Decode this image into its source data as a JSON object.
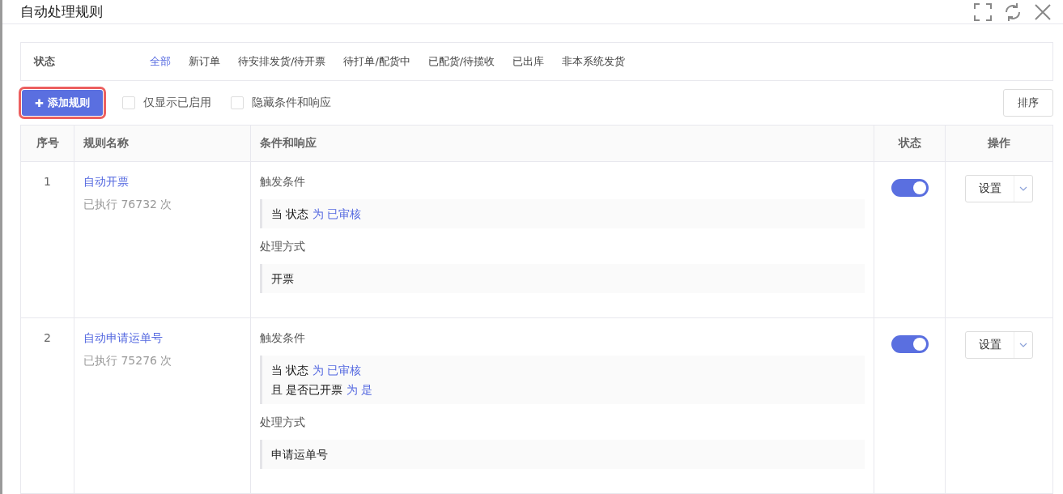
{
  "window": {
    "title": "自动处理规则"
  },
  "filter": {
    "label": "状态",
    "options": [
      {
        "label": "全部",
        "selected": true
      },
      {
        "label": "新订单",
        "selected": false
      },
      {
        "label": "待安排发货/待开票",
        "selected": false
      },
      {
        "label": "待打单/配货中",
        "selected": false
      },
      {
        "label": "已配货/待揽收",
        "selected": false
      },
      {
        "label": "已出库",
        "selected": false
      },
      {
        "label": "非本系统发货",
        "selected": false
      }
    ]
  },
  "toolbar": {
    "add_button": "添加规则",
    "add_icon": "✚",
    "checkboxes": [
      {
        "label": "仅显示已启用",
        "checked": false
      },
      {
        "label": "隐藏条件和响应",
        "checked": false
      }
    ],
    "sort_button": "排序"
  },
  "table": {
    "columns": [
      "序号",
      "规则名称",
      "条件和响应",
      "状态",
      "操作"
    ],
    "rows": [
      {
        "index": "1",
        "name": "自动开票",
        "executed": "已执行 76732 次",
        "trigger_label": "触发条件",
        "conditions": [
          [
            {
              "kind": "word",
              "text": "当"
            },
            {
              "kind": "field",
              "text": "状态"
            },
            {
              "kind": "op",
              "text": "为"
            },
            {
              "kind": "value",
              "text": "已审核"
            }
          ]
        ],
        "action_label": "处理方式",
        "action": "开票",
        "on": true,
        "button": "设置"
      },
      {
        "index": "2",
        "name": "自动申请运单号",
        "executed": "已执行 75276 次",
        "trigger_label": "触发条件",
        "conditions": [
          [
            {
              "kind": "word",
              "text": "当"
            },
            {
              "kind": "field",
              "text": "状态"
            },
            {
              "kind": "op",
              "text": "为"
            },
            {
              "kind": "value",
              "text": "已审核"
            }
          ],
          [
            {
              "kind": "word",
              "text": "且"
            },
            {
              "kind": "field",
              "text": "是否已开票"
            },
            {
              "kind": "op",
              "text": "为"
            },
            {
              "kind": "value",
              "text": "是"
            }
          ]
        ],
        "action_label": "处理方式",
        "action": "申请运单号",
        "on": true,
        "button": "设置"
      }
    ]
  }
}
